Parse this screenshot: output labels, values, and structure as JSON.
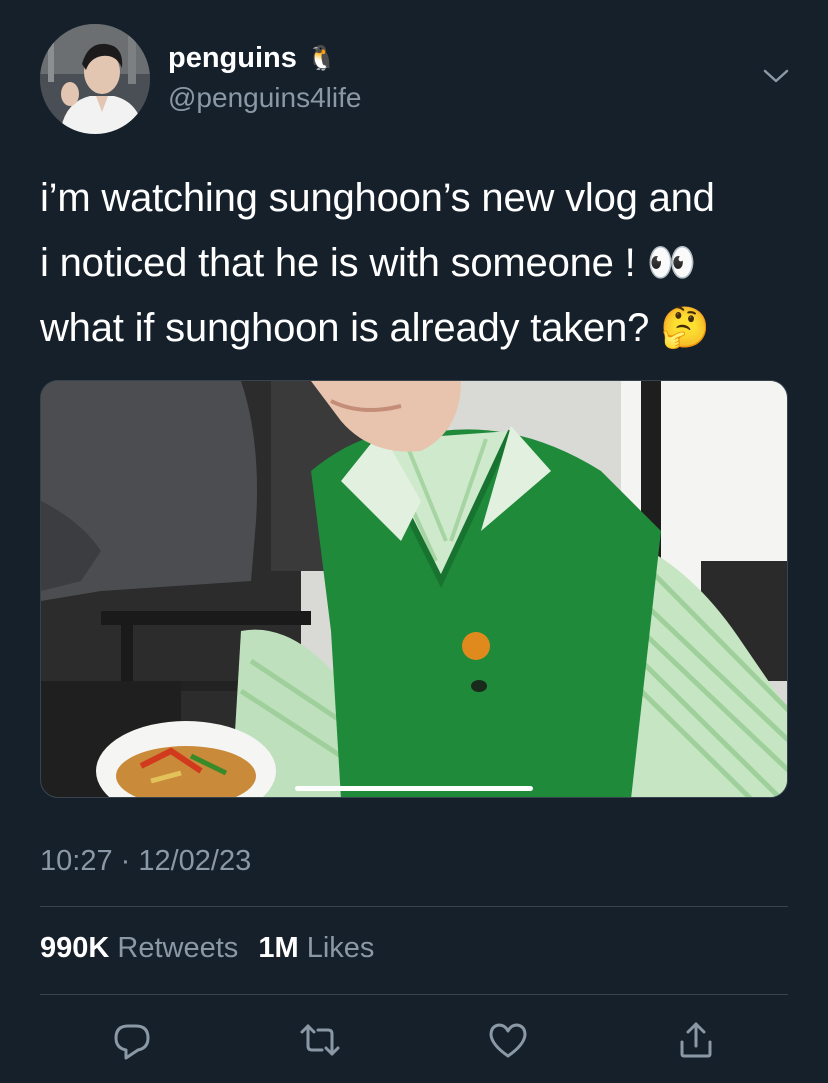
{
  "user": {
    "display_name": "penguins",
    "name_emoji": "🐧",
    "handle": "@penguins4life",
    "avatar_icon": "avatar-photo",
    "more_icon": "chevron-down-icon"
  },
  "tweet": {
    "lines": [
      "i’m watching sunghoon’s new vlog and",
      "i noticed that he is with someone ! 👀",
      "what if sunghoon is already taken? 🤔"
    ],
    "timestamp": "10:27 · 12/02/23"
  },
  "stats": {
    "retweets_count": "990K",
    "retweets_label": "Retweets",
    "likes_count": "1M",
    "likes_label": "Likes"
  },
  "actions": [
    {
      "icon": "reply-icon"
    },
    {
      "icon": "retweet-icon"
    },
    {
      "icon": "like-icon"
    },
    {
      "icon": "share-icon"
    }
  ],
  "colors": {
    "background": "#15202b",
    "text": "#ffffff",
    "secondary": "#8b98a5",
    "divider": "#38444d"
  }
}
